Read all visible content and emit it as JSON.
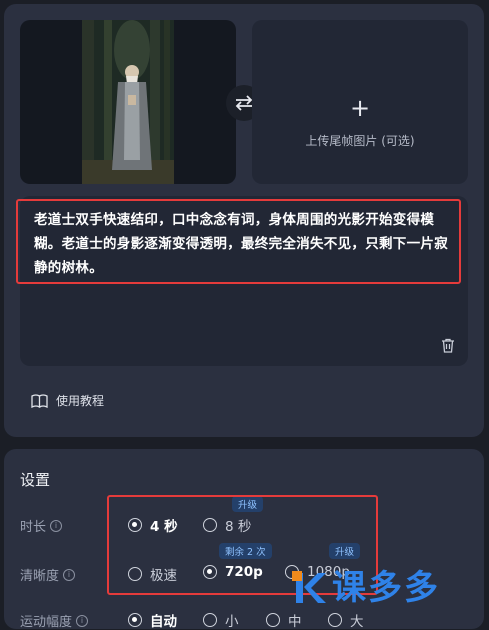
{
  "upload": {
    "last_frame_label": "上传尾帧图片 (可选)"
  },
  "prompt": {
    "text": "老道士双手快速结印，口中念念有词，身体周围的光影开始变得模糊。老道士的身影逐渐变得透明，最终完全消失不见，只剩下一片寂静的树林。"
  },
  "tutorial": {
    "label": "使用教程"
  },
  "settings": {
    "title": "设置",
    "duration": {
      "label": "时长",
      "options": [
        {
          "label": "4 秒",
          "selected": true
        },
        {
          "label": "8 秒",
          "selected": false,
          "badge": "升级"
        }
      ]
    },
    "resolution": {
      "label": "清晰度",
      "options": [
        {
          "label": "极速",
          "selected": false
        },
        {
          "label": "720p",
          "selected": true,
          "badge": "剩余 2 次"
        },
        {
          "label": "1080p",
          "selected": false,
          "badge": "升级"
        }
      ]
    },
    "motion": {
      "label": "运动幅度",
      "options": [
        {
          "label": "自动",
          "selected": true
        },
        {
          "label": "小",
          "selected": false
        },
        {
          "label": "中",
          "selected": false
        },
        {
          "label": "大",
          "selected": false
        }
      ]
    }
  },
  "watermark": {
    "text": "课多多"
  },
  "colors": {
    "highlight": "#e53b3b",
    "badge_bg": "#24406a",
    "badge_text": "#8fc2ff"
  }
}
